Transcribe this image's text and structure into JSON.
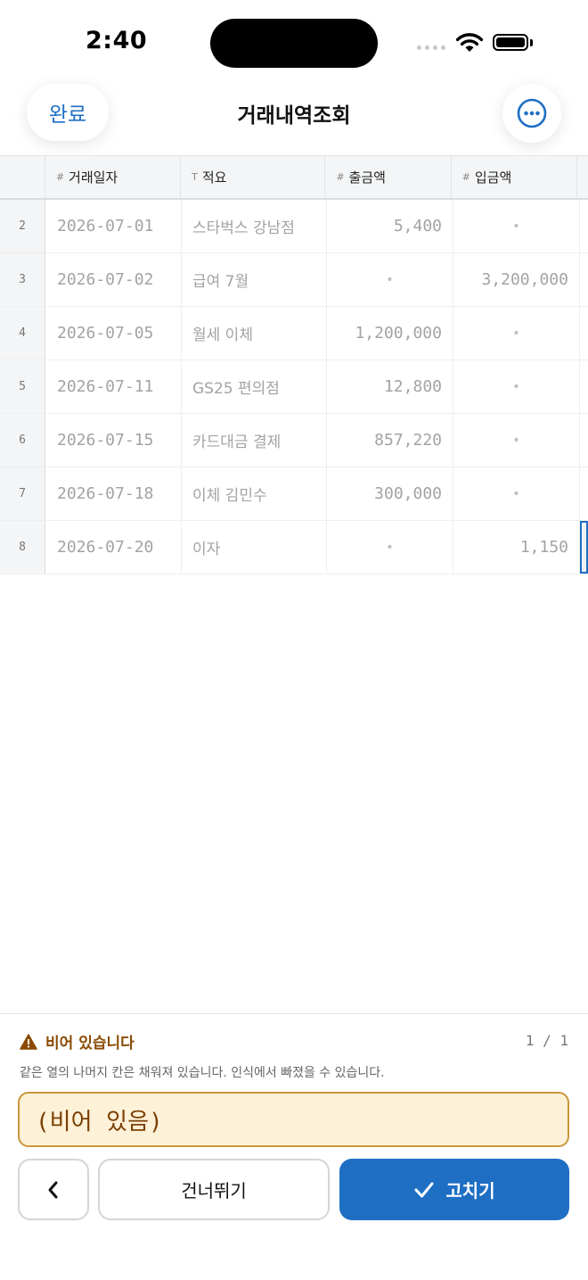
{
  "status": {
    "time": "2:40"
  },
  "nav": {
    "done_label": "완료",
    "title": "거래내역조회",
    "more_icon": "ellipsis-circle-icon"
  },
  "table": {
    "columns": [
      {
        "type": "#",
        "label": "거래일자"
      },
      {
        "type": "T",
        "label": "적요"
      },
      {
        "type": "#",
        "label": "출금액"
      },
      {
        "type": "#",
        "label": "입금액"
      }
    ],
    "rows": [
      {
        "n": "2",
        "date": "2026-07-01",
        "memo": "스타벅스 강남점",
        "out": "5,400",
        "in": "•"
      },
      {
        "n": "3",
        "date": "2026-07-02",
        "memo": "급여 7월",
        "out": "•",
        "in": "3,200,000"
      },
      {
        "n": "4",
        "date": "2026-07-05",
        "memo": "월세 이체",
        "out": "1,200,000",
        "in": "•"
      },
      {
        "n": "5",
        "date": "2026-07-11",
        "memo": "GS25 편의점",
        "out": "12,800",
        "in": "•"
      },
      {
        "n": "6",
        "date": "2026-07-15",
        "memo": "카드대금 결제",
        "out": "857,220",
        "in": "•"
      },
      {
        "n": "7",
        "date": "2026-07-18",
        "memo": "이체 김민수",
        "out": "300,000",
        "in": "•"
      },
      {
        "n": "8",
        "date": "2026-07-20",
        "memo": "이자",
        "out": "•",
        "in": "1,150"
      }
    ]
  },
  "issue": {
    "title": "비어 있습니다",
    "counter": "1 / 1",
    "description": "같은 열의 나머지 칸은 채워져 있습니다. 인식에서 빠졌을 수 있습니다.",
    "value": "(비어 있음)"
  },
  "actions": {
    "prev_icon": "chevron-left-icon",
    "skip_label": "건너뛰기",
    "fix_label": "고치기"
  },
  "colors": {
    "accent": "#1e6fc4",
    "warning": "#8a4a00",
    "warning_bg": "#fdf1d8"
  }
}
